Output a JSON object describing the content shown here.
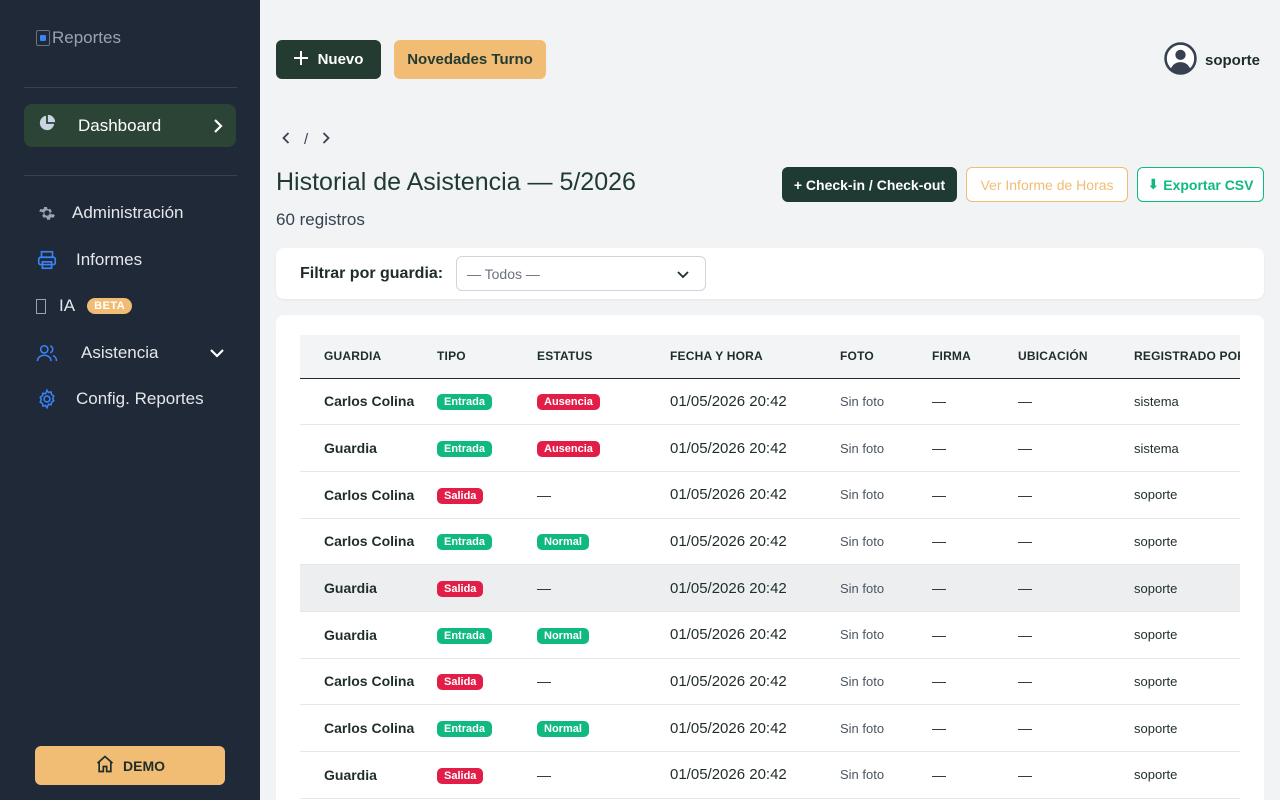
{
  "app": {
    "logo_alt": "Reportes"
  },
  "sidebar": {
    "dashboard": "Dashboard",
    "items": [
      {
        "label": "Administración",
        "icon": "gear-icon"
      },
      {
        "label": "Informes",
        "icon": "printer-icon"
      },
      {
        "label": "IA",
        "icon": "broken-glyph-icon",
        "badge": "BETA"
      },
      {
        "label": "Asistencia",
        "icon": "users-icon"
      },
      {
        "label": "Config. Reportes",
        "icon": "cog-icon"
      }
    ],
    "demo_label": "DEMO"
  },
  "topbar": {
    "new_label": "Nuevo",
    "novedades_label": "Novedades Turno",
    "user_name": "soporte"
  },
  "breadcrumb": {
    "separator": "/"
  },
  "page": {
    "title": "Historial de Asistencia — 5/2026",
    "count": "60 registros",
    "checkin_label": "+ Check-in / Check-out",
    "horas_label": "Ver Informe de Horas",
    "csv_label": "Exportar CSV"
  },
  "filter": {
    "label": "Filtrar por guardia:",
    "selected": "— Todos —"
  },
  "table": {
    "columns": [
      "GUARDIA",
      "TIPO",
      "ESTATUS",
      "FECHA Y HORA",
      "FOTO",
      "FIRMA",
      "UBICACIÓN",
      "REGISTRADO POR"
    ],
    "rows": [
      {
        "guardia": "Carlos Colina",
        "tipo": "Entrada",
        "estatus": "Ausencia",
        "fecha": "01/05/2026 20:42",
        "foto": "Sin foto",
        "firma": "—",
        "ubicacion": "—",
        "registrado": "sistema"
      },
      {
        "guardia": "Guardia",
        "tipo": "Entrada",
        "estatus": "Ausencia",
        "fecha": "01/05/2026 20:42",
        "foto": "Sin foto",
        "firma": "—",
        "ubicacion": "—",
        "registrado": "sistema"
      },
      {
        "guardia": "Carlos Colina",
        "tipo": "Salida",
        "estatus": "—",
        "fecha": "01/05/2026 20:42",
        "foto": "Sin foto",
        "firma": "—",
        "ubicacion": "—",
        "registrado": "soporte"
      },
      {
        "guardia": "Carlos Colina",
        "tipo": "Entrada",
        "estatus": "Normal",
        "fecha": "01/05/2026 20:42",
        "foto": "Sin foto",
        "firma": "—",
        "ubicacion": "—",
        "registrado": "soporte"
      },
      {
        "guardia": "Guardia",
        "tipo": "Salida",
        "estatus": "—",
        "fecha": "01/05/2026 20:42",
        "foto": "Sin foto",
        "firma": "—",
        "ubicacion": "—",
        "registrado": "soporte"
      },
      {
        "guardia": "Guardia",
        "tipo": "Entrada",
        "estatus": "Normal",
        "fecha": "01/05/2026 20:42",
        "foto": "Sin foto",
        "firma": "—",
        "ubicacion": "—",
        "registrado": "soporte"
      },
      {
        "guardia": "Carlos Colina",
        "tipo": "Salida",
        "estatus": "—",
        "fecha": "01/05/2026 20:42",
        "foto": "Sin foto",
        "firma": "—",
        "ubicacion": "—",
        "registrado": "soporte"
      },
      {
        "guardia": "Carlos Colina",
        "tipo": "Entrada",
        "estatus": "Normal",
        "fecha": "01/05/2026 20:42",
        "foto": "Sin foto",
        "firma": "—",
        "ubicacion": "—",
        "registrado": "soporte"
      },
      {
        "guardia": "Guardia",
        "tipo": "Salida",
        "estatus": "—",
        "fecha": "01/05/2026 20:42",
        "foto": "Sin foto",
        "firma": "—",
        "ubicacion": "—",
        "registrado": "soporte"
      }
    ]
  },
  "colors": {
    "sidebar_bg": "#1f2937",
    "primary_dark": "#243b32",
    "accent_orange": "#f1bd74",
    "success_green": "#10b981",
    "danger_red": "#e11d48"
  }
}
